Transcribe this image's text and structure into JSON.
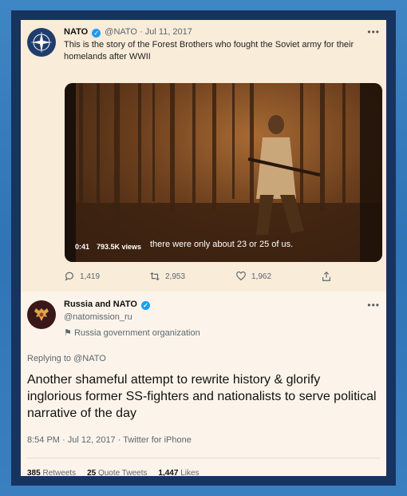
{
  "tweet1": {
    "author_name": "NATO",
    "author_handle": "@NATO",
    "date": "· Jul 11, 2017",
    "text": "This is the story of the Forest Brothers who fought the Soviet army for their homelands after WWII",
    "video": {
      "duration": "0:41",
      "views": "793.5K views",
      "caption": "there were only about 23 or 25 of us."
    },
    "actions": {
      "replies": "1,419",
      "retweets": "2,953",
      "likes": "1,962"
    }
  },
  "tweet2": {
    "author_name": "Russia and NATO",
    "author_handle": "@natomission_ru",
    "org_label": "Russia government organization",
    "replying_to": "Replying to @NATO",
    "text": "Another shameful attempt to rewrite history & glorify inglorious former SS-fighters and nationalists to serve political narrative of the day",
    "timestamp": "8:54 PM · Jul 12, 2017 · Twitter for iPhone",
    "stats": {
      "retweets_count": "385",
      "retweets_label": "Retweets",
      "quotes_count": "25",
      "quotes_label": "Quote Tweets",
      "likes_count": "1,447",
      "likes_label": "Likes"
    }
  },
  "more_label": "•••",
  "colors": {
    "accent": "#1d9bf0",
    "frame": "#17335f",
    "background": "#3a80c0"
  }
}
